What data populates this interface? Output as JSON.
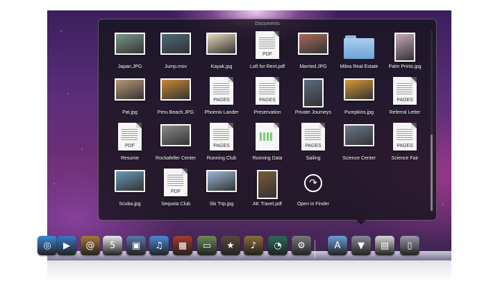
{
  "stack": {
    "title": "Documents",
    "items": [
      {
        "label": "Japan.JPG",
        "kind": "photo",
        "color": "#7a9a8a"
      },
      {
        "label": "Jump.mov",
        "kind": "photo",
        "color": "#4a6a78"
      },
      {
        "label": "Kayak.jpg",
        "kind": "photo",
        "color": "#e8d8b8"
      },
      {
        "label": "Loft for Rent.pdf",
        "kind": "doc",
        "tag": "PDF"
      },
      {
        "label": "Married.JPG",
        "kind": "photo",
        "color": "#a86a5a"
      },
      {
        "label": "Milea Real Estate",
        "kind": "folder"
      },
      {
        "label": "Palm Prints.jpg",
        "kind": "photo-tall",
        "color": "#c8a8b8"
      },
      {
        "label": "Pat.jpg",
        "kind": "photo",
        "color": "#b89878"
      },
      {
        "label": "Peru Beach.JPG",
        "kind": "photo",
        "color": "#c88838"
      },
      {
        "label": "Phoenix Lander",
        "kind": "doc",
        "tag": "PAGES"
      },
      {
        "label": "Preservation",
        "kind": "doc",
        "tag": "PAGES"
      },
      {
        "label": "Private Journeys",
        "kind": "photo-tall",
        "color": "#5a6a7a"
      },
      {
        "label": "Pumpkins.jpg",
        "kind": "photo",
        "color": "#d89838"
      },
      {
        "label": "Referral Letter",
        "kind": "doc",
        "tag": "PAGES"
      },
      {
        "label": "Resume",
        "kind": "doc",
        "tag": "PDF"
      },
      {
        "label": "Rockafeller Center",
        "kind": "photo",
        "color": "#8a8a8a"
      },
      {
        "label": "Running Club",
        "kind": "doc",
        "tag": "PAGES"
      },
      {
        "label": "Running Data",
        "kind": "chart-doc",
        "tag": ""
      },
      {
        "label": "Sailing",
        "kind": "doc",
        "tag": "PAGES"
      },
      {
        "label": "Science Center",
        "kind": "photo",
        "color": "#6a7a8a"
      },
      {
        "label": "Science Fair",
        "kind": "doc",
        "tag": "PAGES"
      },
      {
        "label": "Scuba.jpg",
        "kind": "photo",
        "color": "#6a9ab8"
      },
      {
        "label": "Sequoia Club",
        "kind": "doc",
        "tag": "PDF"
      },
      {
        "label": "Ski Trip.jpg",
        "kind": "photo",
        "color": "#9ab8d8"
      },
      {
        "label": "AK Travel.pdf",
        "kind": "photo-tall",
        "color": "#7a5a3a"
      },
      {
        "label": "Open in Finder",
        "kind": "finder"
      }
    ]
  },
  "dock": {
    "icons": [
      {
        "name": "safari-icon",
        "color": "#3a8ad8",
        "glyph": "◎"
      },
      {
        "name": "facetime-icon",
        "color": "#3a78c8",
        "glyph": "▶"
      },
      {
        "name": "address-book-icon",
        "color": "#a87838",
        "glyph": "@"
      },
      {
        "name": "ical-icon",
        "color": "#e8e8e8",
        "glyph": "5"
      },
      {
        "name": "preview-icon",
        "color": "#5a7aa8",
        "glyph": "▣"
      },
      {
        "name": "itunes-icon",
        "color": "#4a8ad8",
        "glyph": "♫"
      },
      {
        "name": "photo-booth-icon",
        "color": "#a83a2a",
        "glyph": "▦"
      },
      {
        "name": "iphoto-icon",
        "color": "#6a8a5a",
        "glyph": "▭"
      },
      {
        "name": "imovie-icon",
        "color": "#5a4a3a",
        "glyph": "★"
      },
      {
        "name": "garageband-icon",
        "color": "#8a6a3a",
        "glyph": "♪"
      },
      {
        "name": "time-machine-icon",
        "color": "#2a6a5a",
        "glyph": "◔"
      },
      {
        "name": "system-preferences-icon",
        "color": "#7a7a7a",
        "glyph": "⚙"
      },
      {
        "name": "applications-folder-icon",
        "color": "#6aa0d8",
        "glyph": "A"
      },
      {
        "name": "documents-folder-icon",
        "color": "#8a8a9a",
        "glyph": "▼"
      },
      {
        "name": "downloads-stack-icon",
        "color": "#d8d8d8",
        "glyph": "▤"
      },
      {
        "name": "trash-icon",
        "color": "#9a9aa8",
        "glyph": "▯"
      }
    ]
  }
}
